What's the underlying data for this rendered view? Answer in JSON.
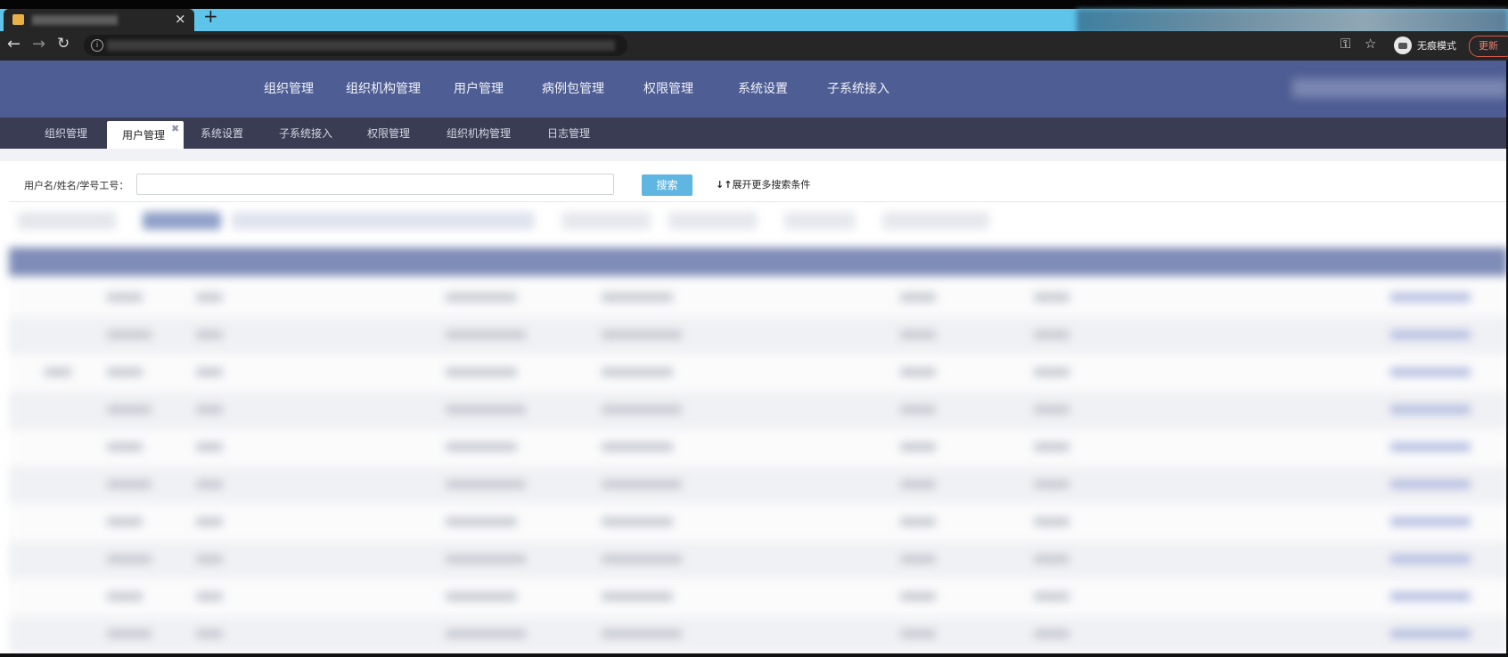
{
  "browser": {
    "tab_close_glyph": "×",
    "new_tab_glyph": "+",
    "incognito_label": "无痕模式",
    "update_label": "更新",
    "icons": [
      "back-arrow-icon",
      "forward-arrow-icon",
      "reload-icon",
      "info-icon",
      "key-icon",
      "star-icon",
      "incognito-icon"
    ]
  },
  "top_nav": {
    "items": [
      "组织管理",
      "组织机构管理",
      "用户管理",
      "病例包管理",
      "权限管理",
      "系统设置",
      "子系统接入"
    ]
  },
  "tabs": {
    "items": [
      "组织管理",
      "用户管理",
      "系统设置",
      "子系统接入",
      "权限管理",
      "组织机构管理",
      "日志管理"
    ],
    "active": "用户管理",
    "close_glyph": "✖"
  },
  "search": {
    "label": "用户名/姓名/学号工号：",
    "input_value": "",
    "button_label": "搜索",
    "more_label": "展开更多搜索条件",
    "more_icon": "↓↑"
  },
  "colors": {
    "header_bg": "#4e5d94",
    "tabrow_bg": "#393c53",
    "search_button": "#5fb6e1",
    "chrome_tabstrip": "#5ec4ea"
  }
}
